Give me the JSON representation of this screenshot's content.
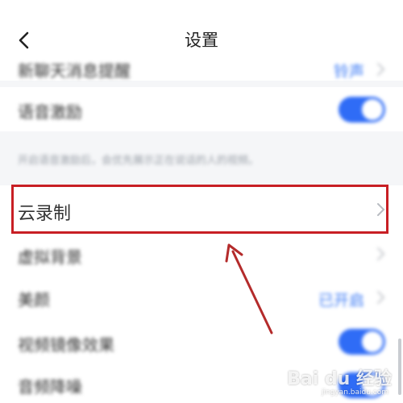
{
  "header": {
    "title": "设置",
    "back_icon": "chevron-left-icon"
  },
  "rows": {
    "new_message_reminder": {
      "label": "新聊天消息提醒",
      "value": "铃声"
    },
    "voice_reward": {
      "label": "语音激励",
      "toggle": "on"
    },
    "hint": "开启语音激励后，会优先展示正在说话的人的视频。",
    "cloud_recording": {
      "label": "云录制"
    },
    "virtual_background": {
      "label": "虚拟背景"
    },
    "beauty": {
      "label": "美颜",
      "value": "已开启"
    },
    "video_mirror": {
      "label": "视频镜像效果",
      "toggle": "on"
    },
    "audio_noise": {
      "label": "音频降噪",
      "toggle": "on"
    }
  },
  "watermark": {
    "text": "Bai du 经验",
    "sub": "jingyan.baidu.com"
  },
  "colors": {
    "accent": "#2f6cf6",
    "highlight": "#c81f24",
    "arrow": "#b42b2b"
  }
}
